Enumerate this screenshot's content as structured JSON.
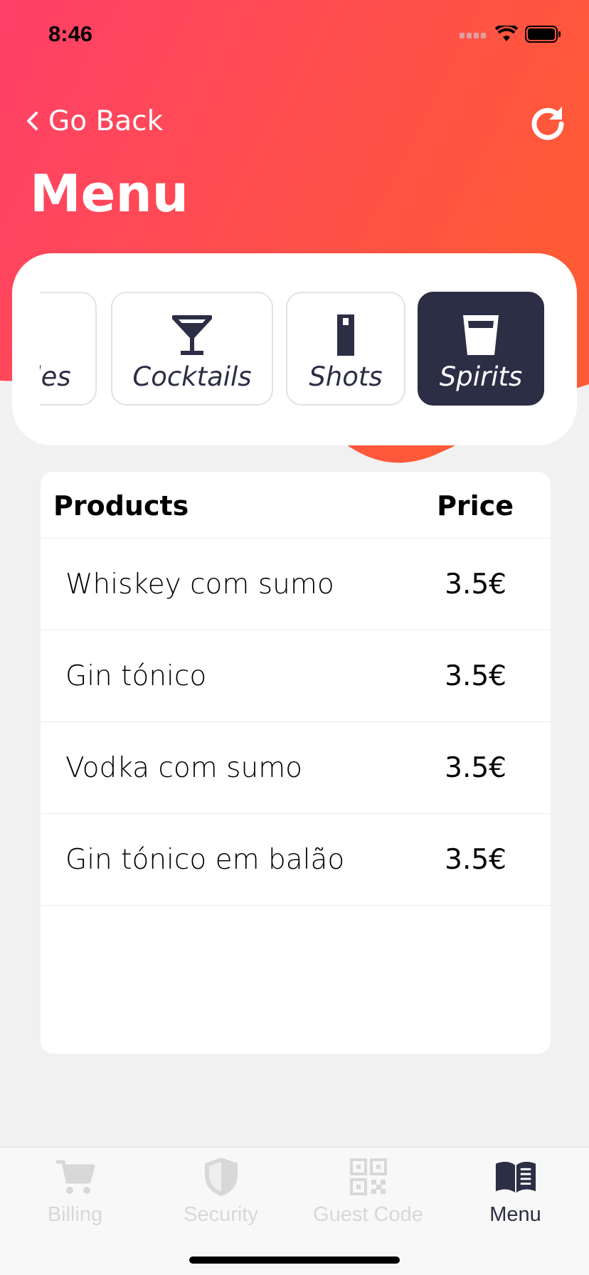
{
  "status": {
    "time": "8:46"
  },
  "nav": {
    "back_label": "Go Back",
    "title": "Menu"
  },
  "categories": [
    {
      "label": "Bottles",
      "icon": "bottle-icon",
      "active": false
    },
    {
      "label": "Cocktails",
      "icon": "cocktail-icon",
      "active": false
    },
    {
      "label": "Shots",
      "icon": "shot-icon",
      "active": false
    },
    {
      "label": "Spirits",
      "icon": "glass-icon",
      "active": true
    }
  ],
  "table": {
    "header_products": "Products",
    "header_price": "Price",
    "rows": [
      {
        "name": "Whiskey com sumo",
        "price": "3.5€"
      },
      {
        "name": "Gin tónico",
        "price": "3.5€"
      },
      {
        "name": "Vodka com sumo",
        "price": "3.5€"
      },
      {
        "name": "Gin tónico em balão",
        "price": "3.5€"
      }
    ]
  },
  "tabs": [
    {
      "label": "Billing",
      "icon": "cart-icon",
      "active": false
    },
    {
      "label": "Security",
      "icon": "shield-icon",
      "active": false
    },
    {
      "label": "Guest Code",
      "icon": "qr-code-icon",
      "active": false
    },
    {
      "label": "Menu",
      "icon": "book-icon",
      "active": true
    }
  ],
  "colors": {
    "gradient_start": "#ff4069",
    "gradient_end": "#ff5a36",
    "accent_dark": "#2c2e45",
    "inactive_tab": "#d8d8d8"
  }
}
